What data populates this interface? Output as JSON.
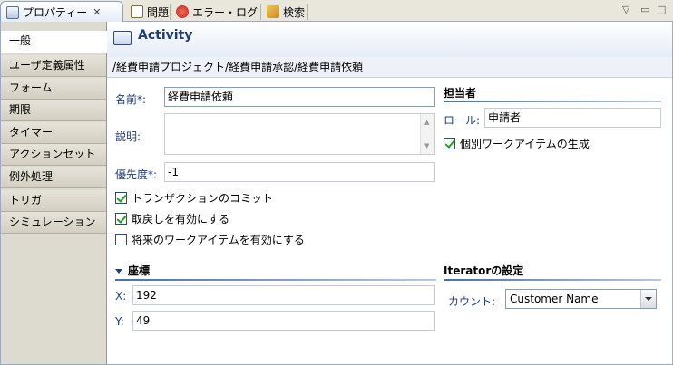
{
  "tabs": [
    {
      "label": "プロパティー",
      "icon": "properties-icon"
    },
    {
      "label": "問題",
      "icon": "problems-icon"
    },
    {
      "label": "エラー・ログ",
      "icon": "error-log-icon"
    },
    {
      "label": "検索",
      "icon": "search-icon"
    }
  ],
  "nav": [
    "一般",
    "ユーザ定義属性",
    "フォーム",
    "期限",
    "タイマー",
    "アクションセット",
    "例外処理",
    "トリガ",
    "シミュレーション"
  ],
  "header": {
    "title": "Activity",
    "path": "/経費申請プロジェクト/経費申請承認/経費申請依頼"
  },
  "form": {
    "name_label": "名前*:",
    "name_value": "経費申請依頼",
    "desc_label": "説明:",
    "priority_label": "優先度*:",
    "priority_value": "-1",
    "checkboxes": [
      {
        "label": "トランザクションのコミット",
        "checked": true
      },
      {
        "label": "取戻しを有効にする",
        "checked": true
      },
      {
        "label": "将来のワークアイテムを有効にする",
        "checked": false
      }
    ]
  },
  "assignee": {
    "title": "担当者",
    "role_label": "ロール:",
    "role_value": "申請者",
    "individual_label": "個別ワークアイテムの生成",
    "individual_checked": true
  },
  "coords": {
    "title": "座標",
    "x_label": "X:",
    "x_value": "192",
    "y_label": "Y:",
    "y_value": "49"
  },
  "iterator": {
    "title": "Iteratorの設定",
    "count_label": "カウント:",
    "count_value": "Customer Name"
  },
  "colors": {
    "accent": "#1f3d7a",
    "tab_bg": "#e9e7dc",
    "nav_bg": "#dddad0",
    "check": "#21a121"
  }
}
